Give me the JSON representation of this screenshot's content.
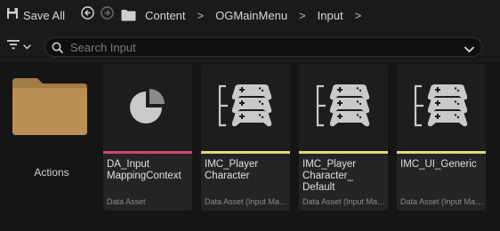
{
  "toolbar": {
    "save_all_label": "Save All",
    "breadcrumbs": [
      "Content",
      "OGMainMenu",
      "Input"
    ],
    "separator": ">"
  },
  "search": {
    "placeholder": "Search Input",
    "value": ""
  },
  "folder": {
    "label": "Actions",
    "color": "#b98f55"
  },
  "assets": [
    {
      "name": "DA_Input MappingContext",
      "type": "Data Asset",
      "stripe_color": "#d2466b",
      "icon": "pie-chart-icon"
    },
    {
      "name": "IMC_Player Character",
      "type": "Data Asset (Input Mapping Context)",
      "stripe_color": "#e0d878",
      "icon": "input-mapping-icon"
    },
    {
      "name": "IMC_Player Character_ Default",
      "type": "Data Asset (Input Mapping Context)",
      "stripe_color": "#e0d878",
      "icon": "input-mapping-icon"
    },
    {
      "name": "IMC_UI_Generic",
      "type": "Data Asset (Input Mapping Context)",
      "stripe_color": "#e0d878",
      "icon": "input-mapping-icon"
    }
  ],
  "colors": {
    "background": "#151515",
    "card": "#242424",
    "data_asset_stripe": "#d2466b",
    "imc_stripe": "#e0d878"
  }
}
